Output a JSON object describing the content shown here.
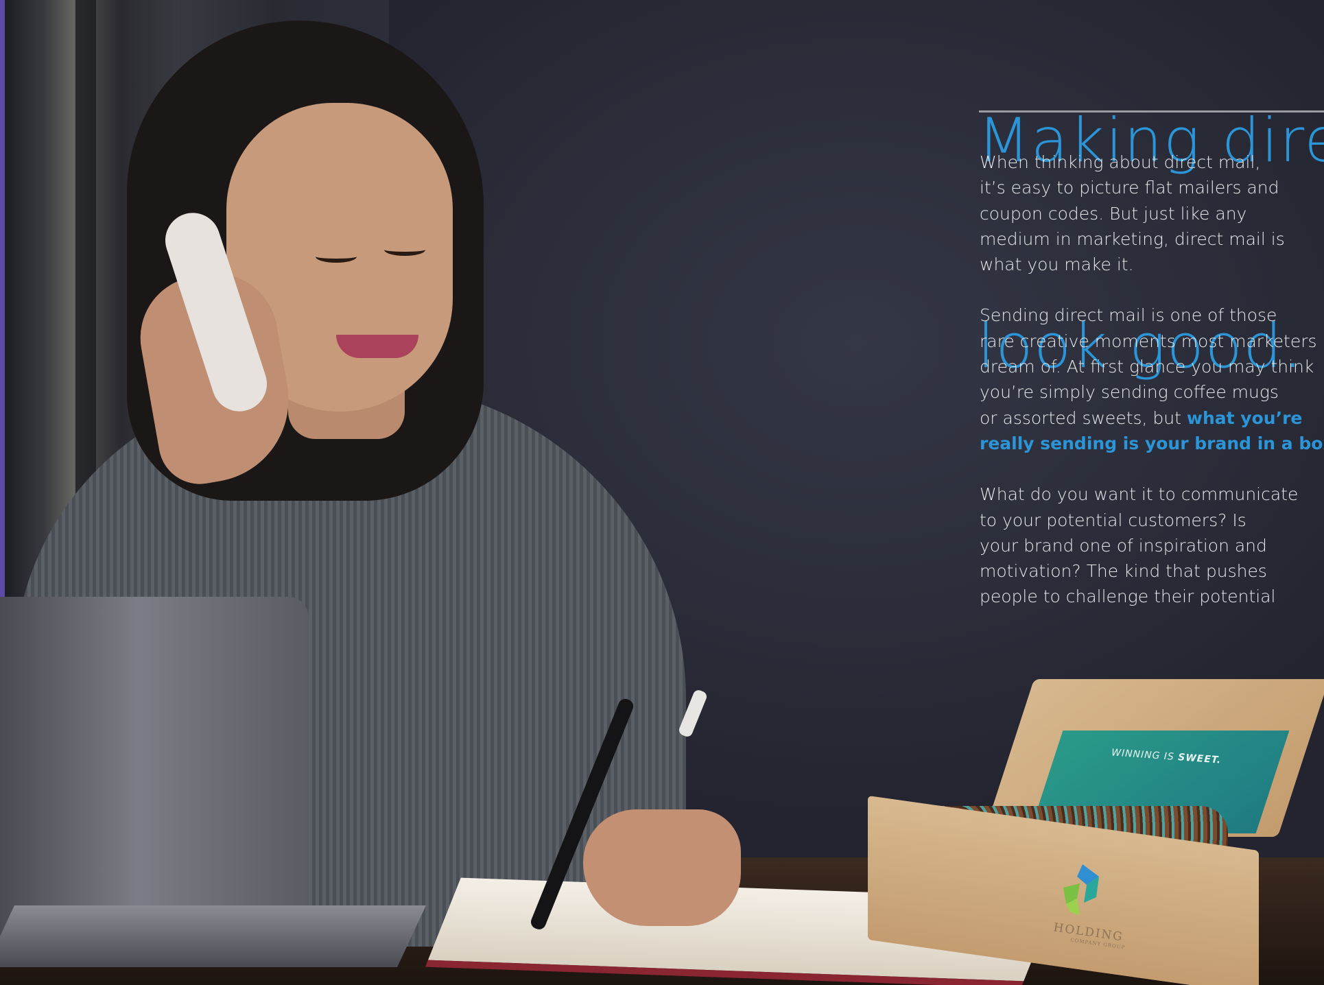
{
  "headline": {
    "line1": "Making direc",
    "line2": "look good."
  },
  "paragraph1": [
    "When thinking about direct mail,",
    "it’s easy to picture flat mailers and",
    "coupon codes. But just like any",
    "medium in marketing, direct mail is",
    "what you make it."
  ],
  "paragraph2": {
    "lines": [
      "Sending direct mail is one of those",
      "rare creative moments most marketers",
      "dream of. At first glance you may think",
      "you’re simply sending coffee mugs"
    ],
    "line5_prefix": "or assorted sweets, but ",
    "line5_highlight": "what you’re",
    "line6_highlight": "really sending is your brand in a box",
    "line6_suffix": "."
  },
  "paragraph3": [
    "What do you want it to communicate",
    "to your potential customers? Is",
    "your brand one of inspiration and",
    "motivation? The kind that pushes",
    "people to challenge their potential"
  ],
  "box": {
    "card_text_prefix": "WINNING IS ",
    "card_text_bold": "SWEET.",
    "logo_name": "HOLDING",
    "logo_sub": "COMPANY GROUP",
    "logo_icon": "holding-logo-icon"
  },
  "colors": {
    "accent": "#2b95d7",
    "background": "#2b2d3a",
    "body_text": "#e6e7ea",
    "side_bar": "#5b4aa6"
  }
}
